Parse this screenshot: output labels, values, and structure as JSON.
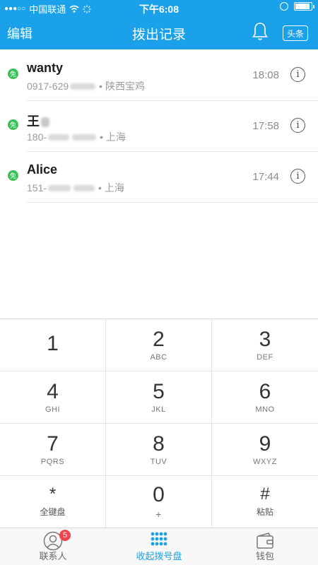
{
  "status_bar": {
    "carrier": "中国联通",
    "time": "下午6:08"
  },
  "nav": {
    "edit_label": "编辑",
    "title": "拨出记录",
    "toutiao_label": "头条"
  },
  "calls": [
    {
      "badge": "免",
      "name": "wanty",
      "number_prefix": "0917-629",
      "location": "• 陕西宝鸡",
      "time": "18:08"
    },
    {
      "badge": "免",
      "name": "王",
      "number_prefix": "180-",
      "location": "• 上海",
      "time": "17:58"
    },
    {
      "badge": "免",
      "name": "Alice",
      "number_prefix": "151-",
      "location": "• 上海",
      "time": "17:44"
    }
  ],
  "info_glyph": "i",
  "keypad": {
    "keys": [
      {
        "main": "1",
        "sub": ""
      },
      {
        "main": "2",
        "sub": "ABC"
      },
      {
        "main": "3",
        "sub": "DEF"
      },
      {
        "main": "4",
        "sub": "GHI"
      },
      {
        "main": "5",
        "sub": "JKL"
      },
      {
        "main": "6",
        "sub": "MNO"
      },
      {
        "main": "7",
        "sub": "PQRS"
      },
      {
        "main": "8",
        "sub": "TUV"
      },
      {
        "main": "9",
        "sub": "WXYZ"
      },
      {
        "main": "*",
        "sub": "全键盘"
      },
      {
        "main": "0",
        "sub": "+"
      },
      {
        "main": "#",
        "sub": "粘贴"
      }
    ]
  },
  "tabs": {
    "contacts_label": "联系人",
    "contacts_badge": "5",
    "dialpad_label": "收起拨号盘",
    "wallet_label": "钱包"
  },
  "colors": {
    "brand": "#1aa1ea",
    "free_badge": "#3bbf58",
    "notification_badge": "#f0434c"
  }
}
